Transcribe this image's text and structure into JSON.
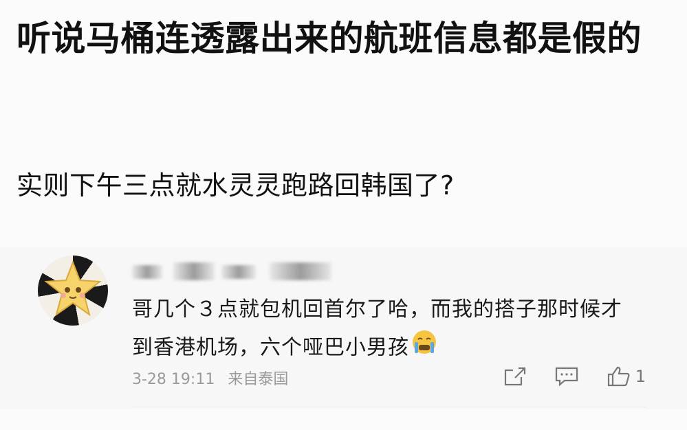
{
  "post": {
    "title": "听说马桶连透露出来的航班信息都是假的",
    "body": "实则下午三点就水灵灵跑路回韩国了?"
  },
  "comment": {
    "avatar_icon": "star-mascot-avatar",
    "username_redacted": true,
    "text": "哥几个３点就包机回首尔了哈，而我的搭子那时候才到香港机场，六个哑巴小男孩",
    "emoji_icon": "crying-face-emoji",
    "date": "3-28 19:11",
    "source": "来自泰国",
    "like_count": "1",
    "icons": [
      "share-icon",
      "comment-icon",
      "like-icon"
    ]
  },
  "colors": {
    "background": "#fbfbfb",
    "comment_bg": "#f7f7f7",
    "meta_text": "#9a9a9a",
    "emoji": "#f5c542"
  }
}
